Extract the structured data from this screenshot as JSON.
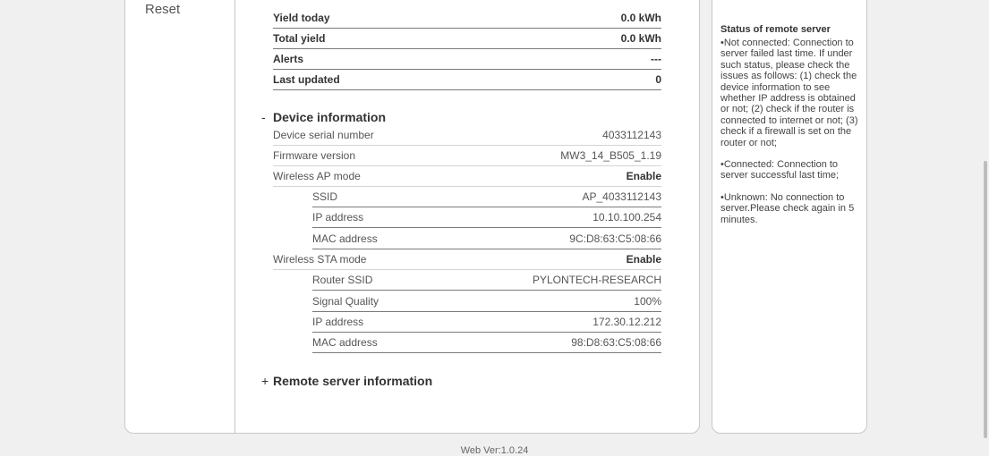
{
  "sidebar": {
    "reset_label": "Reset"
  },
  "yield_rows": [
    {
      "label": "Yield today",
      "value": "0.0 kWh"
    },
    {
      "label": "Total yield",
      "value": "0.0 kWh"
    },
    {
      "label": "Alerts",
      "value": "---"
    },
    {
      "label": "Last updated",
      "value": "0"
    }
  ],
  "device_info": {
    "toggle": "-",
    "title": "Device information",
    "serial_label": "Device serial number",
    "serial_value": "4033112143",
    "firmware_label": "Firmware version",
    "firmware_value": "MW3_14_B505_1.19",
    "ap_label": "Wireless AP mode",
    "ap_value": "Enable",
    "ap_rows": [
      {
        "label": "SSID",
        "value": "AP_4033112143"
      },
      {
        "label": "IP address",
        "value": "10.10.100.254"
      },
      {
        "label": "MAC address",
        "value": "9C:D8:63:C5:08:66"
      }
    ],
    "sta_label": "Wireless STA mode",
    "sta_value": "Enable",
    "sta_rows": [
      {
        "label": "Router SSID",
        "value": "PYLONTECH-RESEARCH"
      },
      {
        "label": "Signal Quality",
        "value": "100%"
      },
      {
        "label": "IP address",
        "value": "172.30.12.212"
      },
      {
        "label": "MAC address",
        "value": "98:D8:63:C5:08:66"
      }
    ]
  },
  "remote_server": {
    "toggle": "+",
    "title": "Remote server information"
  },
  "help": {
    "title": "Status of remote server",
    "p1": "•Not connected: Connection to server failed last time. If under such status, please check the issues as follows: (1) check the device information to see whether IP address is obtained or not; (2) check if the router is connected to internet or not; (3) check if a firewall is set on the router or not;",
    "p2": "•Connected: Connection to server successful last time;",
    "p3": "•Unknown: No connection to server.Please check again in 5 minutes."
  },
  "footer": {
    "version": "Web Ver:1.0.24"
  }
}
